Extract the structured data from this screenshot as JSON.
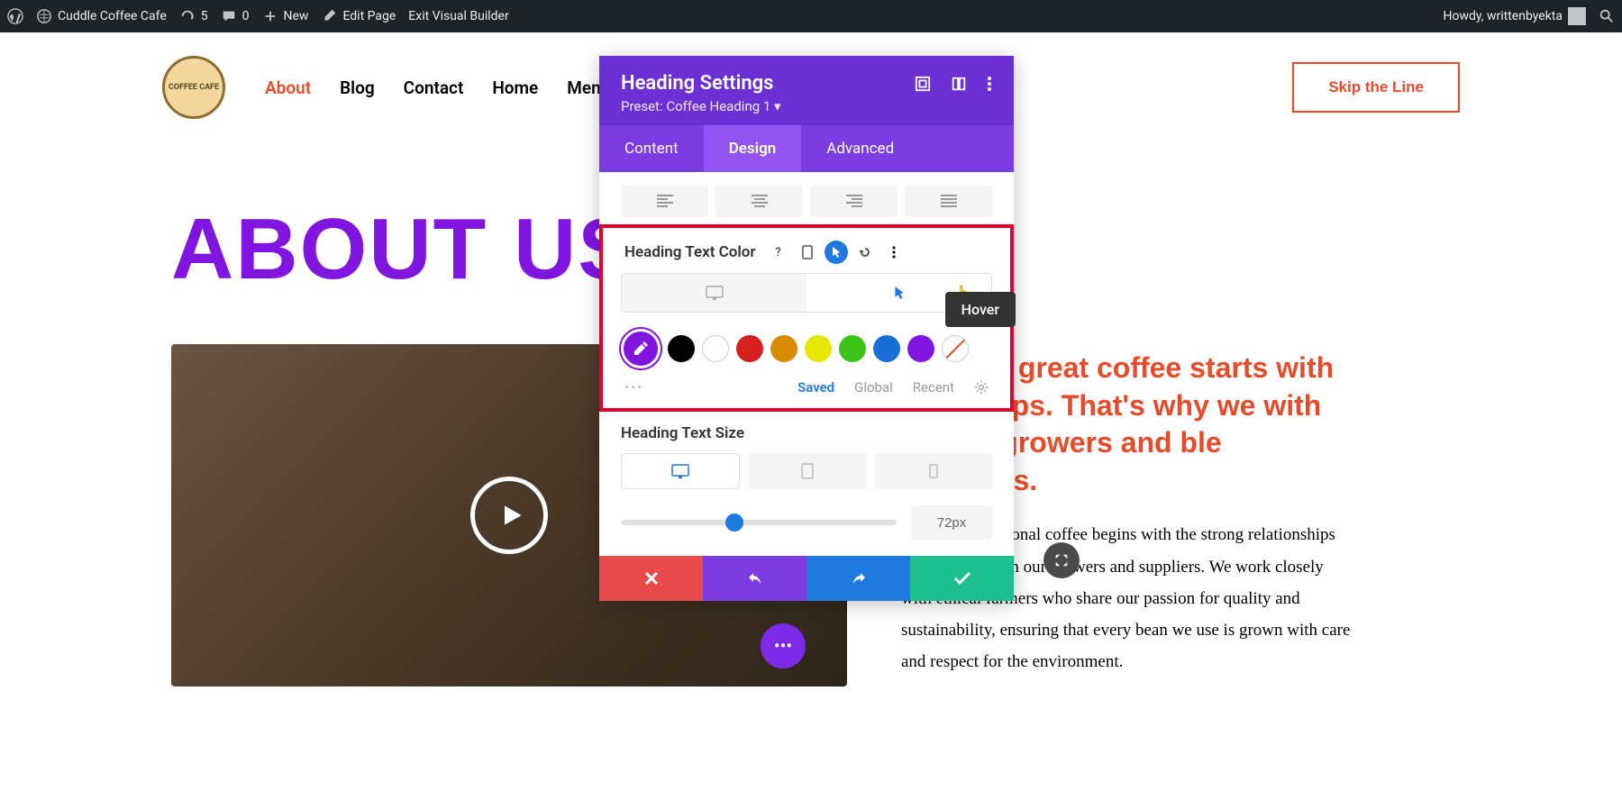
{
  "adminbar": {
    "site": "Cuddle Coffee Cafe",
    "updates": "5",
    "comments": "0",
    "new": "New",
    "edit": "Edit Page",
    "exit": "Exit Visual Builder",
    "howdy": "Howdy, writtenbyekta"
  },
  "nav": {
    "items": [
      "About",
      "Blog",
      "Contact",
      "Home",
      "Menu"
    ],
    "cta": "Skip the Line",
    "logo_text": "COFFEE CAFE"
  },
  "hero": {
    "heading": "ABOUT US"
  },
  "content": {
    "highlight": "eve that great coffee starts with ationships. That's why we with ethical growers and ble suppliers.",
    "body": "tment to exceptional coffee begins with the strong relationships we cultivate with our growers and suppliers. We work closely with ethical farmers who share our passion for quality and sustainability, ensuring that every bean we use is grown with care and respect for the environment."
  },
  "panel": {
    "title": "Heading Settings",
    "preset": "Preset: Coffee Heading 1 ▾",
    "tabs": [
      "Content",
      "Design",
      "Advanced"
    ],
    "color_label": "Heading Text Color",
    "tooltip": "Hover",
    "swatches": [
      "#000000",
      "#ffffff",
      "#d61f1f",
      "#d78b00",
      "#e6e600",
      "#3cc41a",
      "#1a6fd6",
      "#8015e0"
    ],
    "footer_tabs": [
      "Saved",
      "Global",
      "Recent"
    ],
    "size_label": "Heading Text Size",
    "size_value": "72px"
  }
}
